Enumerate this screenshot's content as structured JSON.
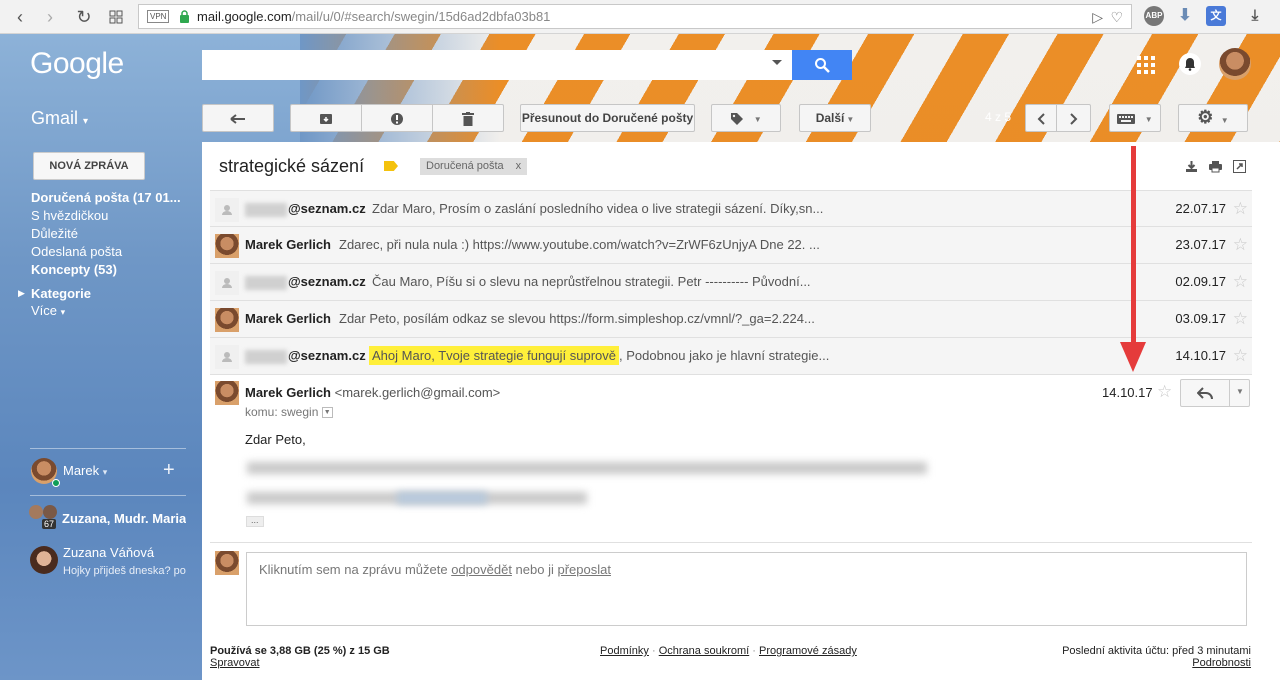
{
  "browser": {
    "vpn": "VPN",
    "url_host": "mail.google.com",
    "url_path": "/mail/u/0/#search/swegin/15d6ad2dbfa03b81",
    "ext_abp": "ABP"
  },
  "header": {
    "logo": "Google",
    "app_label": "Gmail",
    "search_value": ""
  },
  "toolbar": {
    "move_label": "Přesunout do Doručené pošty",
    "more_label": "Další",
    "pager": "4 z 5"
  },
  "sidebar": {
    "compose_label": "NOVÁ ZPRÁVA",
    "items": [
      {
        "label": "Doručená pošta (17 01...",
        "bold": true
      },
      {
        "label": "S hvězdičkou",
        "bold": false
      },
      {
        "label": "Důležité",
        "bold": false
      },
      {
        "label": "Odeslaná pošta",
        "bold": false
      },
      {
        "label": "Koncepty (53)",
        "bold": true
      },
      {
        "label": "Kategorie",
        "bold": true
      },
      {
        "label": "Více",
        "bold": false
      }
    ],
    "chat": {
      "me": "Marek",
      "group": "Zuzana, Mudr. Maria",
      "group_count": "67",
      "contact_name": "Zuzana Váňová",
      "contact_status": "Hojky přijdeš dneska? po"
    }
  },
  "thread": {
    "subject": "strategické sázení",
    "tag": "Doručená pošta",
    "tag_remove": "x",
    "messages": [
      {
        "sender": "@seznam.cz",
        "snippet": "Zdar Maro, Prosím o zaslání posledního videa o live strategii sázení. Díky,sn...",
        "date": "22.07.17",
        "highlight": ""
      },
      {
        "sender": "Marek Gerlich",
        "snippet": "Zdarec, při nula nula :) https://www.youtube.com/watch?v=ZrWF6zUnjyA Dne 22. ...",
        "date": "23.07.17",
        "highlight": ""
      },
      {
        "sender": "@seznam.cz",
        "snippet": "Čau Maro, Píšu si o slevu na neprůstřelnou strategii. Petr ---------- Původní...",
        "date": "02.09.17",
        "highlight": ""
      },
      {
        "sender": "Marek Gerlich",
        "snippet": "Zdar Peto, posílám odkaz se slevou https://form.simpleshop.cz/vmnl/?_ga=2.224...",
        "date": "03.09.17",
        "highlight": ""
      },
      {
        "sender": "@seznam.cz",
        "snippet": ", Podobnou jako je hlavní strategie...",
        "date": "14.10.17",
        "highlight": "Ahoj Maro, Tvoje strategie fungují suprově"
      }
    ],
    "open": {
      "sender": "Marek Gerlich",
      "email": "<marek.gerlich@gmail.com>",
      "to": "komu: swegin",
      "date": "14.10.17",
      "greeting": "Zdar Peto,",
      "ellipsis": "..."
    },
    "reply_prompt": {
      "pre": "Kliknutím sem na zprávu můžete ",
      "reply": "odpovědět",
      "mid": " nebo ji ",
      "forward": "přeposlat"
    }
  },
  "footer": {
    "storage": "Používá se 3,88 GB (25 %) z 15 GB",
    "manage": "Spravovat",
    "terms": "Podmínky",
    "privacy": "Ochrana soukromí",
    "policy": "Programové zásady",
    "sep": "·",
    "activity": "Poslední aktivita účtu: před 3 minutami",
    "details": "Podrobnosti"
  },
  "colors": {
    "accent_blue": "#4285f4",
    "highlight": "#ffef3a",
    "arrow_red": "#e53b3b",
    "label_yellow": "#f4c20d"
  }
}
